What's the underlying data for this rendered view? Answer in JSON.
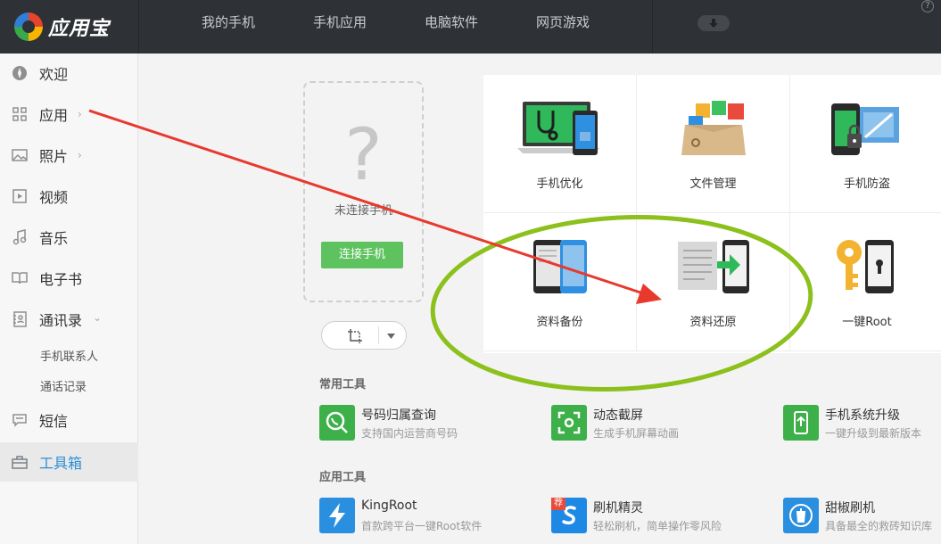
{
  "app": {
    "name": "应用宝"
  },
  "topnav": [
    "我的手机",
    "手机应用",
    "电脑软件",
    "网页游戏"
  ],
  "help": "?",
  "sidebar": {
    "items": [
      {
        "label": "欢迎",
        "icon": "compass-icon",
        "chevron": ""
      },
      {
        "label": "应用",
        "icon": "grid-icon",
        "chevron": "›"
      },
      {
        "label": "照片",
        "icon": "image-icon",
        "chevron": "›"
      },
      {
        "label": "视频",
        "icon": "video-icon",
        "chevron": ""
      },
      {
        "label": "音乐",
        "icon": "music-icon",
        "chevron": ""
      },
      {
        "label": "电子书",
        "icon": "book-icon",
        "chevron": ""
      },
      {
        "label": "通讯录",
        "icon": "contacts-icon",
        "chevron": "⌄"
      },
      {
        "label": "短信",
        "icon": "message-icon",
        "chevron": ""
      },
      {
        "label": "工具箱",
        "icon": "toolbox-icon",
        "chevron": ""
      }
    ],
    "subitems": [
      "手机联系人",
      "通话记录"
    ],
    "active": "工具箱"
  },
  "device": {
    "placeholder": "?",
    "status": "未连接手机",
    "connect_label": "连接手机"
  },
  "features": [
    {
      "label": "手机优化",
      "icon": "phone-optimize-icon"
    },
    {
      "label": "文件管理",
      "icon": "file-manager-icon"
    },
    {
      "label": "手机防盗",
      "icon": "anti-theft-icon"
    },
    {
      "label": "资料备份",
      "icon": "data-backup-icon"
    },
    {
      "label": "资料还原",
      "icon": "data-restore-icon"
    },
    {
      "label": "一键Root",
      "icon": "one-click-root-icon"
    }
  ],
  "sections": {
    "common": "常用工具",
    "apps": "应用工具"
  },
  "common_tools": [
    {
      "name": "号码归属查询",
      "desc": "支持国内运营商号码",
      "color": "#3db04a",
      "icon": "phone-lookup-icon"
    },
    {
      "name": "动态截屏",
      "desc": "生成手机屏幕动画",
      "color": "#3db04a",
      "icon": "screen-capture-icon"
    },
    {
      "name": "手机系统升级",
      "desc": "一键升级到最新版本",
      "color": "#3db04a",
      "icon": "system-upgrade-icon"
    }
  ],
  "app_tools": [
    {
      "name": "KingRoot",
      "desc": "首款跨平台一键Root软件",
      "color": "#2b8fe0",
      "icon": "lightning-icon"
    },
    {
      "name": "刷机精灵",
      "desc": "轻松刷机，简单操作零风险",
      "color": "#1e88e5",
      "icon": "flash-genie-icon",
      "badge": "荐"
    },
    {
      "name": "甜椒刷机",
      "desc": "具备最全的救砖知识库",
      "color": "#2b8fe0",
      "icon": "pepper-flash-icon"
    }
  ],
  "colors": {
    "accent": "#2d8fd6",
    "green": "#5ec35f",
    "annotation_arrow": "#e8392d",
    "annotation_ellipse": "#8cc01c"
  }
}
